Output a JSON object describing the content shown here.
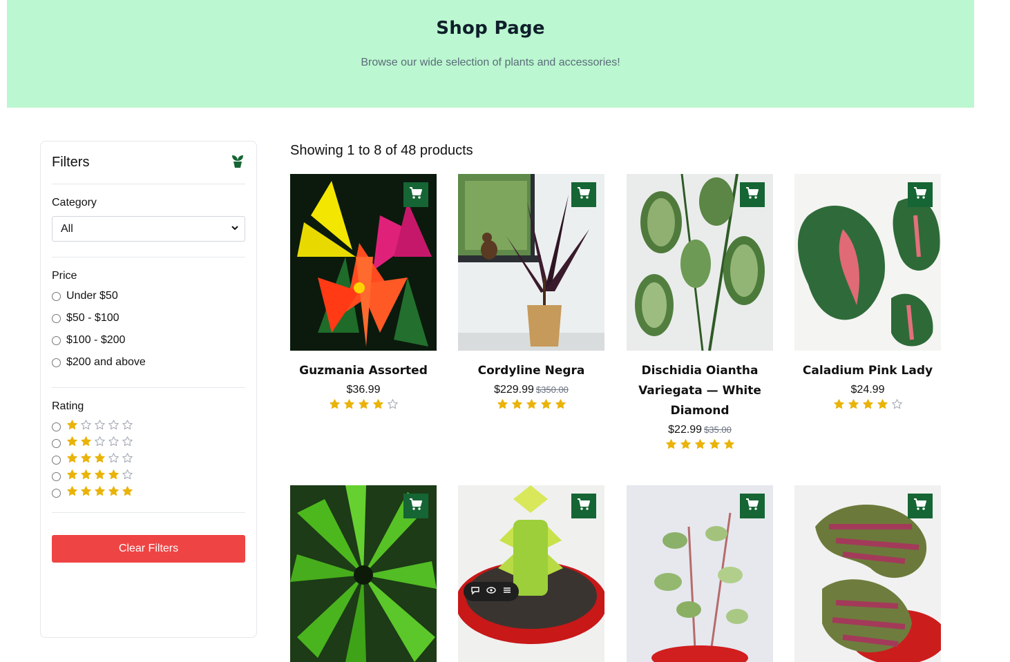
{
  "header": {
    "title": "Shop Page",
    "subtitle": "Browse our wide selection of plants and accessories!"
  },
  "filters": {
    "title": "Filters",
    "category": {
      "label": "Category",
      "selected": "All"
    },
    "price": {
      "label": "Price",
      "options": [
        "Under $50",
        "$50 - $100",
        "$100 - $200",
        "$200 and above"
      ]
    },
    "rating": {
      "label": "Rating",
      "options": [
        1,
        2,
        3,
        4,
        5
      ]
    },
    "clear_label": "Clear Filters"
  },
  "results": {
    "summary": "Showing 1 to 8 of 48 products"
  },
  "products": [
    {
      "name": "Guzmania Assorted",
      "price": "$36.99",
      "old_price": "",
      "rating": 4
    },
    {
      "name": "Cordyline Negra",
      "price": "$229.99",
      "old_price": "$350.00",
      "rating": 5
    },
    {
      "name": "Dischidia Oiantha Variegata — White Diamond",
      "price": "$22.99",
      "old_price": "$35.00",
      "rating": 5
    },
    {
      "name": "Caladium Pink Lady",
      "price": "$24.99",
      "old_price": "",
      "rating": 4
    },
    {
      "name": "",
      "price": "",
      "old_price": "",
      "rating": 0
    },
    {
      "name": "",
      "price": "",
      "old_price": "",
      "rating": 0
    },
    {
      "name": "",
      "price": "",
      "old_price": "",
      "rating": 0
    },
    {
      "name": "",
      "price": "",
      "old_price": "",
      "rating": 0
    }
  ],
  "colors": {
    "hero_bg": "#bbf7d0",
    "cart_button": "#166534",
    "star": "#eab308",
    "clear_button": "#ef4444"
  },
  "icons": {
    "filter_header": "plant-icon",
    "cart": "cart-icon",
    "select": "chevron-down-icon"
  }
}
